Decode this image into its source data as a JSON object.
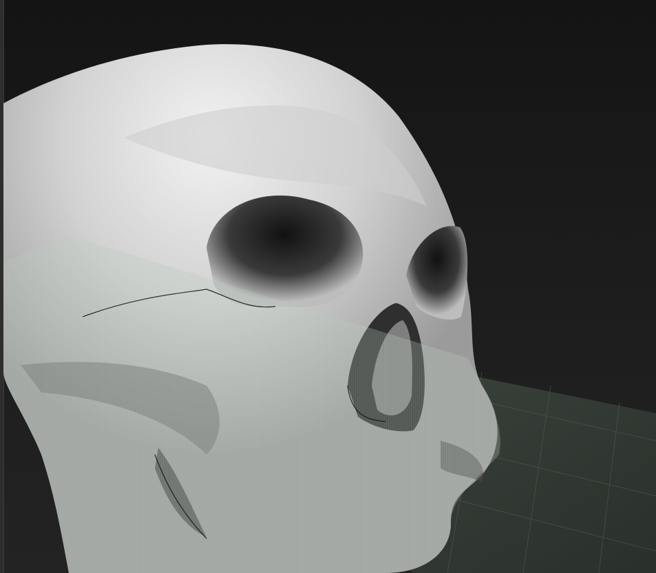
{
  "app": {
    "window_title": ""
  },
  "viewport": {
    "object": "skull-sculpt",
    "floor_grid": true,
    "colors": {
      "background_top": "#141414",
      "background_bottom": "#232323",
      "model_light": "#d9d9d9",
      "model_mid": "#9a9a9a",
      "model_dark": "#2a2a2a",
      "floor_tint": "#5c6a60",
      "floor_grid_line": "#4a554d",
      "gradient_band_tint": "#b7c9b9"
    }
  }
}
